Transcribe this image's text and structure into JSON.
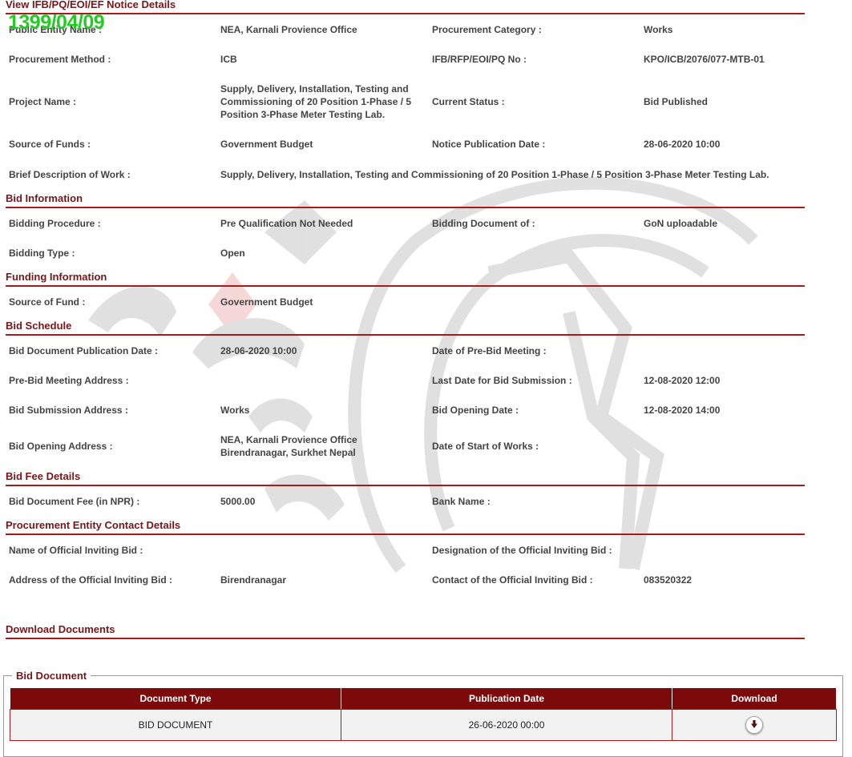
{
  "stamp": "1399/04/09",
  "header": {
    "title": "View IFB/PQ/EOI/EF Notice Details"
  },
  "notice": {
    "public_entity_label": "Public Entity Name :",
    "public_entity_value": "NEA, Karnali Provience Office",
    "procurement_category_label": "Procurement Category :",
    "procurement_category_value": "Works",
    "procurement_method_label": "Procurement Method :",
    "procurement_method_value": "ICB",
    "ifb_no_label": "IFB/RFP/EOI/PQ No :",
    "ifb_no_value": "KPO/ICB/2076/077-MTB-01",
    "project_name_label": "Project Name :",
    "project_name_value": "Supply, Delivery, Installation, Testing and Commissioning of 20 Position 1-Phase / 5 Position 3-Phase Meter Testing Lab.",
    "current_status_label": "Current Status :",
    "current_status_value": "Bid Published",
    "source_of_funds_label": "Source of Funds :",
    "source_of_funds_value": "Government Budget",
    "notice_pub_date_label": "Notice Publication Date :",
    "notice_pub_date_value": "28-06-2020 10:00",
    "brief_desc_label": "Brief Description of Work :",
    "brief_desc_value": "Supply, Delivery, Installation, Testing and Commissioning of 20 Position 1-Phase / 5 Position 3-Phase Meter Testing Lab."
  },
  "bid_information": {
    "title": "Bid Information",
    "bidding_procedure_label": "Bidding Procedure :",
    "bidding_procedure_value": "Pre Qualification Not Needed",
    "bidding_document_label": "Bidding Document of :",
    "bidding_document_value": "GoN uploadable",
    "bidding_type_label": "Bidding Type :",
    "bidding_type_value": "Open"
  },
  "funding_information": {
    "title": "Funding Information",
    "source_of_fund_label": "Source of Fund :",
    "source_of_fund_value": "Government Budget"
  },
  "bid_schedule": {
    "title": "Bid Schedule",
    "doc_pub_date_label": "Bid Document Publication Date :",
    "doc_pub_date_value": "28-06-2020 10:00",
    "pre_bid_meeting_date_label": "Date of Pre-Bid Meeting :",
    "pre_bid_meeting_date_value": "",
    "pre_bid_address_label": "Pre-Bid Meeting Address :",
    "pre_bid_address_value": "",
    "last_date_label": "Last Date for Bid Submission :",
    "last_date_value": "12-08-2020 12:00",
    "submission_address_label": "Bid Submission Address :",
    "submission_address_value": "Works",
    "opening_date_label": "Bid Opening Date :",
    "opening_date_value": "12-08-2020 14:00",
    "opening_address_label": "Bid Opening Address :",
    "opening_address_value": "NEA, Karnali Provience Office Birendranagar, Surkhet Nepal",
    "start_of_works_label": "Date of Start of Works :",
    "start_of_works_value": ""
  },
  "bid_fee": {
    "title": "Bid Fee Details",
    "fee_label": "Bid Document Fee (in NPR) :",
    "fee_value": "5000.00",
    "bank_name_label": "Bank Name :",
    "bank_name_value": ""
  },
  "contact": {
    "title": "Procurement Entity Contact Details",
    "official_name_label": "Name of Official Inviting Bid :",
    "official_name_value": "",
    "designation_label": "Designation of the Official Inviting Bid :",
    "designation_value": "",
    "address_label": "Address of the Official Inviting Bid :",
    "address_value": "Birendranagar",
    "contact_label": "Contact of the Official Inviting Bid :",
    "contact_value": "083520322"
  },
  "download": {
    "title": "Download Documents",
    "fieldset_legend": "Bid Document",
    "columns": [
      "Document Type",
      "Publication Date",
      "Download"
    ],
    "rows": [
      {
        "type": "BID DOCUMENT",
        "date": "26-06-2020 00:00",
        "icon": "download-icon"
      }
    ]
  },
  "colors": {
    "accent": "#a81b1b",
    "table_header": "#7d0a0a",
    "stamp": "#22cc22"
  }
}
